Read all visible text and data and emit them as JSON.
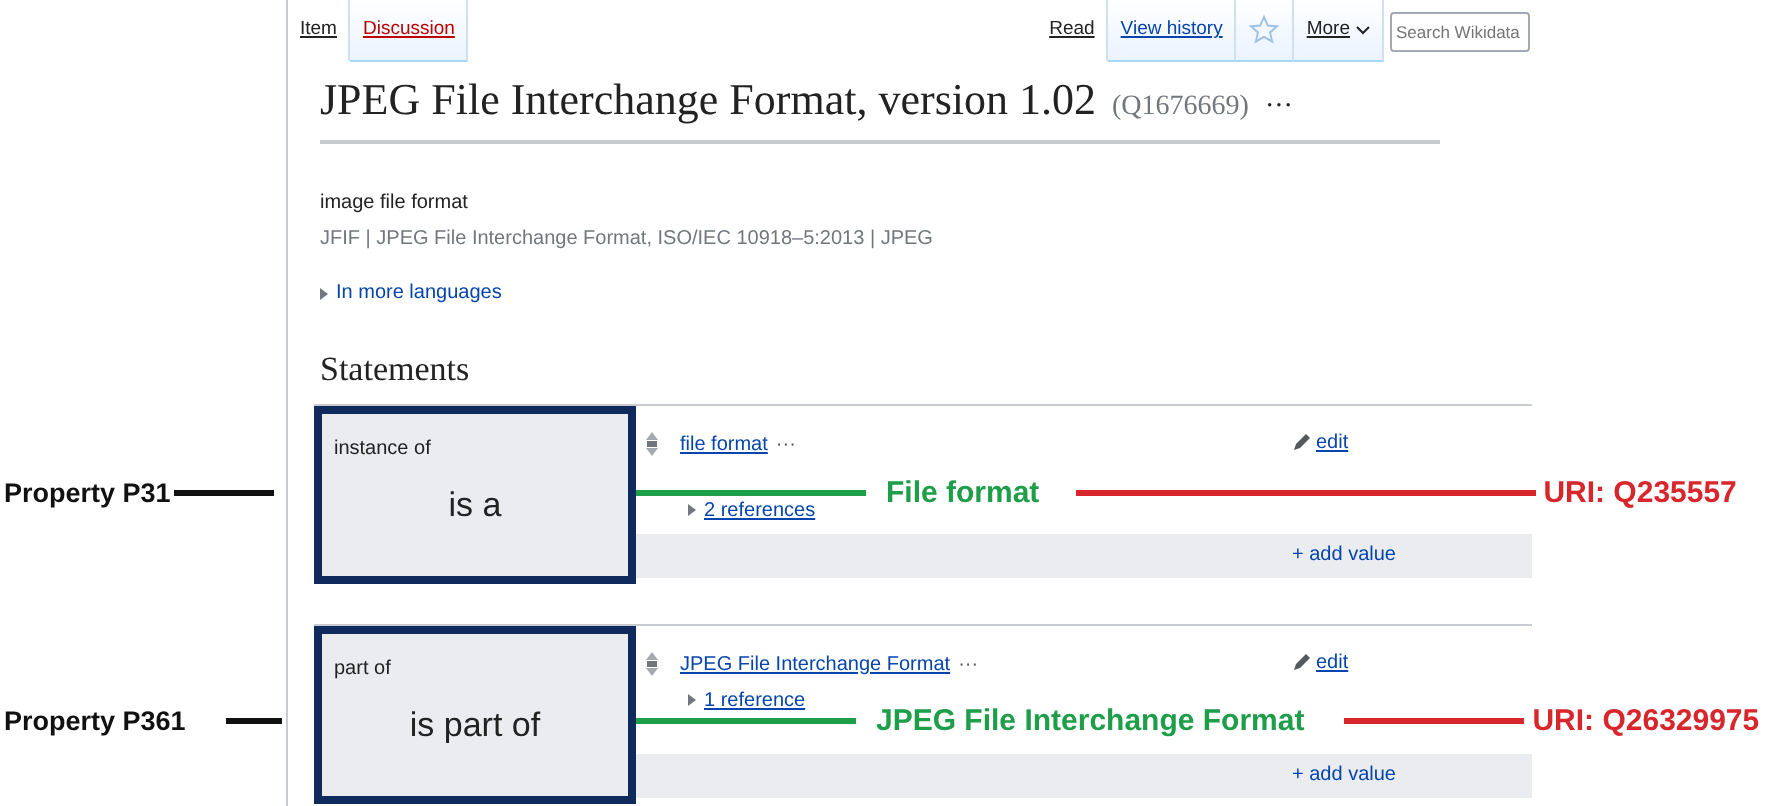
{
  "tabs_left": [
    {
      "label": "Item",
      "selected": true
    },
    {
      "label": "Discussion",
      "selected": false
    }
  ],
  "tabs_right": [
    {
      "label": "Read",
      "selected": true
    },
    {
      "label": "View history",
      "selected": false
    }
  ],
  "more": "More",
  "search": {
    "placeholder": "Search Wikidata"
  },
  "title": "JPEG File Interchange Format, version 1.02",
  "entity_id": "(Q1676669)",
  "title_menu": "···",
  "description": "image file format",
  "aliases": "JFIF | JPEG File Interchange Format, ISO/IEC 10918–5:2013 | JPEG",
  "languages_toggle": "In more languages",
  "statements_heading": "Statements",
  "statements": [
    {
      "property": "instance of",
      "value": "file format",
      "menu": "···",
      "edit": "edit",
      "references": "2 references",
      "add": "+ add value",
      "annotation": {
        "box_text": "is a",
        "property_label": "Property P31",
        "value_label": "File format",
        "uri": "URI: Q235557"
      }
    },
    {
      "property": "part of",
      "value": "JPEG File Interchange Format",
      "menu": "···",
      "edit": "edit",
      "references": "1 reference",
      "add": "+ add value",
      "annotation": {
        "box_text": "is part of",
        "property_label": "Property P361",
        "value_label": "JPEG File Interchange Format",
        "uri": "URI: Q26329975"
      }
    }
  ]
}
